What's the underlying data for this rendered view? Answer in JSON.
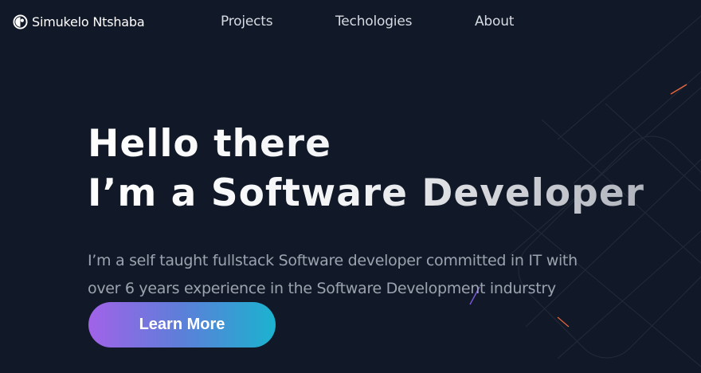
{
  "header": {
    "brand_name": "Simukelo Ntshaba",
    "brand_icon": "logo-icon",
    "nav": [
      {
        "label": "Projects"
      },
      {
        "label": "Techologies"
      },
      {
        "label": "About"
      }
    ]
  },
  "hero": {
    "title_line1": "Hello there",
    "title_line2": "I’m a Software Developer",
    "description_line1": "I’m a self taught fullstack Software developer committed in IT with",
    "description_line2": "over 6 years experience in the Software Development indurstry",
    "cta_label": "Learn More"
  },
  "colors": {
    "background": "#111827",
    "cta_gradient_start": "#a162e8",
    "cta_gradient_end": "#1bb3cf",
    "muted_text": "#9ca3af"
  }
}
